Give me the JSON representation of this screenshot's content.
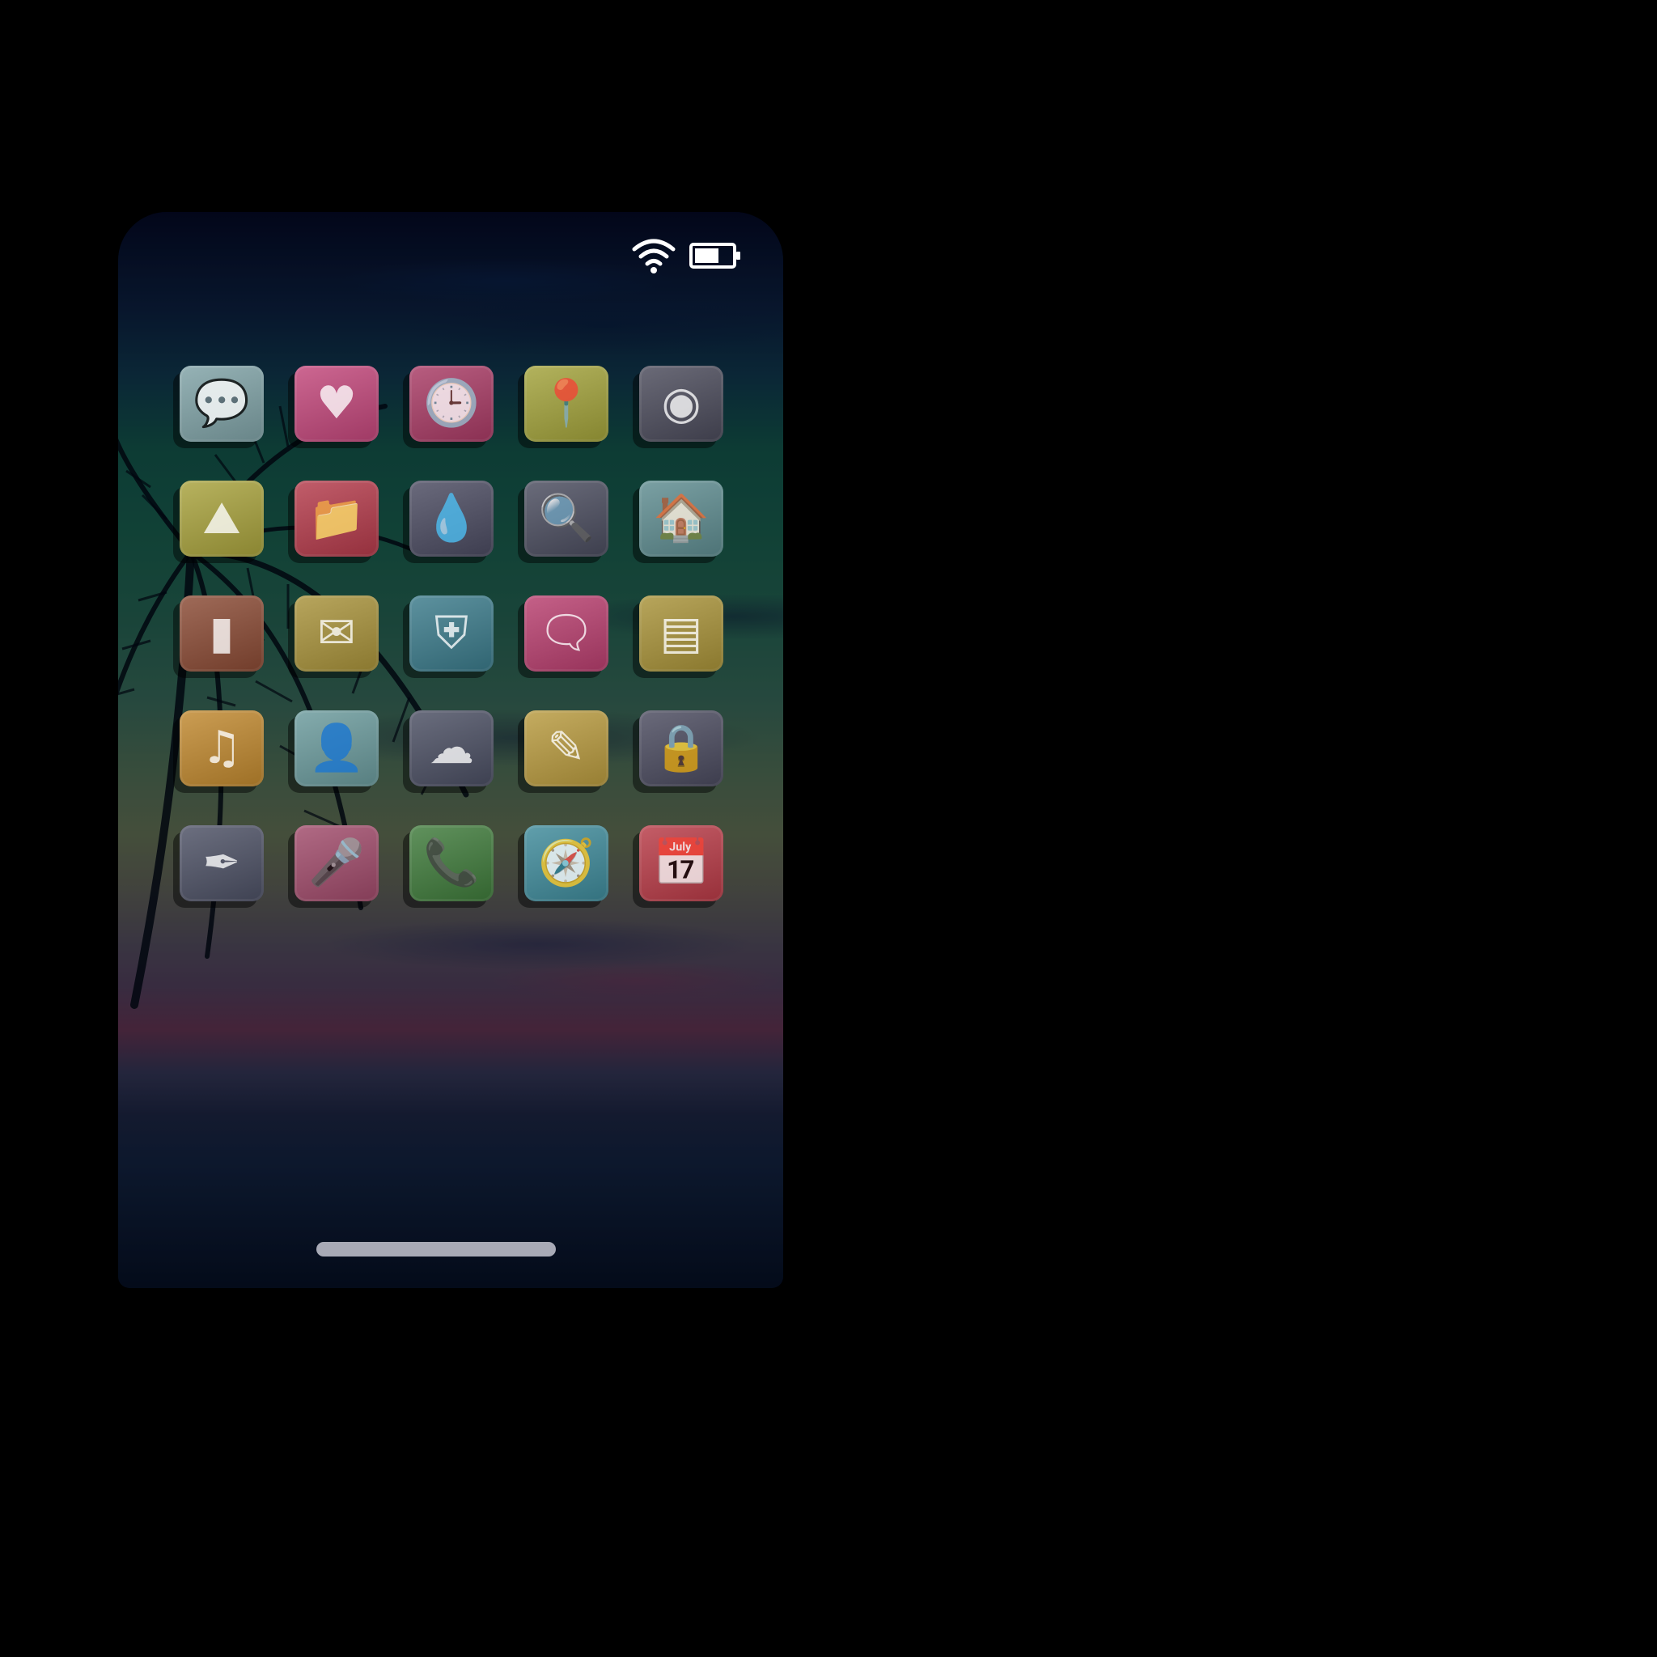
{
  "status_bar": {
    "wifi_icon": "wifi-icon",
    "battery_icon": "battery-icon",
    "battery_level": 0.65
  },
  "apps": [
    {
      "name": "chat-bubble",
      "icon": "chat-bubble-icon",
      "glyph": "💬",
      "color": "#7fa2a6"
    },
    {
      "name": "heart",
      "icon": "heart-icon",
      "glyph": "♥",
      "color": "#c2467a"
    },
    {
      "name": "clock",
      "icon": "clock-icon",
      "glyph": "🕒",
      "color": "#a83a64"
    },
    {
      "name": "map-pin",
      "icon": "map-pin-icon",
      "glyph": "📍",
      "color": "#a2a23a"
    },
    {
      "name": "camera",
      "icon": "camera-lens-icon",
      "glyph": "◉",
      "color": "#4a4a5a"
    },
    {
      "name": "photos",
      "icon": "mountain-photo-icon",
      "glyph": "⛰",
      "color": "#a8a23c"
    },
    {
      "name": "files",
      "icon": "folder-icon",
      "glyph": "📁",
      "color": "#b43a4a"
    },
    {
      "name": "drop",
      "icon": "water-drop-icon",
      "glyph": "💧",
      "color": "#4a4a60"
    },
    {
      "name": "search",
      "icon": "magnifier-icon",
      "glyph": "🔍",
      "color": "#4a4c5e"
    },
    {
      "name": "home",
      "icon": "house-icon",
      "glyph": "🏠",
      "color": "#5e8c90"
    },
    {
      "name": "phone-device",
      "icon": "phone-device-icon",
      "glyph": "▮",
      "color": "#8a4a34"
    },
    {
      "name": "mail",
      "icon": "envelope-icon",
      "glyph": "✉",
      "color": "#a8923a"
    },
    {
      "name": "shield",
      "icon": "shield-icon",
      "glyph": "⛨",
      "color": "#3a7a8a"
    },
    {
      "name": "messages",
      "icon": "message-card-icon",
      "glyph": "🗨",
      "color": "#b83e6e"
    },
    {
      "name": "browser",
      "icon": "window-icon",
      "glyph": "▤",
      "color": "#a89238"
    },
    {
      "name": "music",
      "icon": "music-note-icon",
      "glyph": "♫",
      "color": "#c0882e"
    },
    {
      "name": "contacts",
      "icon": "person-icon",
      "glyph": "👤",
      "color": "#6a9a9c"
    },
    {
      "name": "weather",
      "icon": "cloud-icon",
      "glyph": "☁",
      "color": "#4a4e62"
    },
    {
      "name": "notes",
      "icon": "note-icon",
      "glyph": "✎",
      "color": "#b89a3e"
    },
    {
      "name": "lock",
      "icon": "lock-icon",
      "glyph": "🔒",
      "color": "#4a4a5e"
    },
    {
      "name": "pen",
      "icon": "feather-pen-icon",
      "glyph": "✒",
      "color": "#4c5064"
    },
    {
      "name": "mic",
      "icon": "microphone-icon",
      "glyph": "🎤",
      "color": "#a04a6a"
    },
    {
      "name": "call",
      "icon": "telephone-icon",
      "glyph": "📞",
      "color": "#3e7a3a"
    },
    {
      "name": "compass",
      "icon": "compass-icon",
      "glyph": "🧭",
      "color": "#3e8a9a"
    },
    {
      "name": "calendar",
      "icon": "calendar-icon",
      "glyph": "📅",
      "color": "#b83a46"
    }
  ]
}
